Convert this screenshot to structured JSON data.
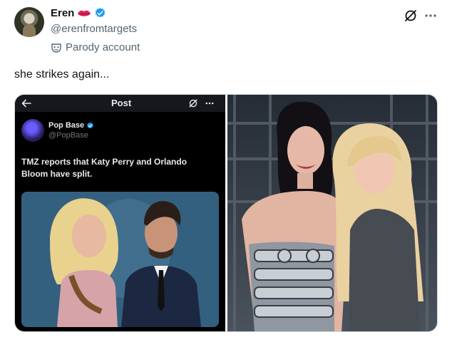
{
  "author": {
    "display_name": "Eren",
    "handle": "@erenfromtargets",
    "parody_label": "Parody account"
  },
  "tweet": {
    "text": "she strikes again..."
  },
  "quoted_screenshot": {
    "header_title": "Post",
    "author_name": "Pop Base",
    "author_handle": "@PopBase",
    "text": "TMZ reports that Katy Perry and Orlando Bloom have split."
  },
  "colors": {
    "verified": "#1d9bf0",
    "secondary_text": "#536471",
    "lips": "#e0245e"
  },
  "icons": [
    "lips-icon",
    "verified-icon",
    "mask-icon",
    "grok-icon",
    "more-icon",
    "back-arrow-icon"
  ]
}
